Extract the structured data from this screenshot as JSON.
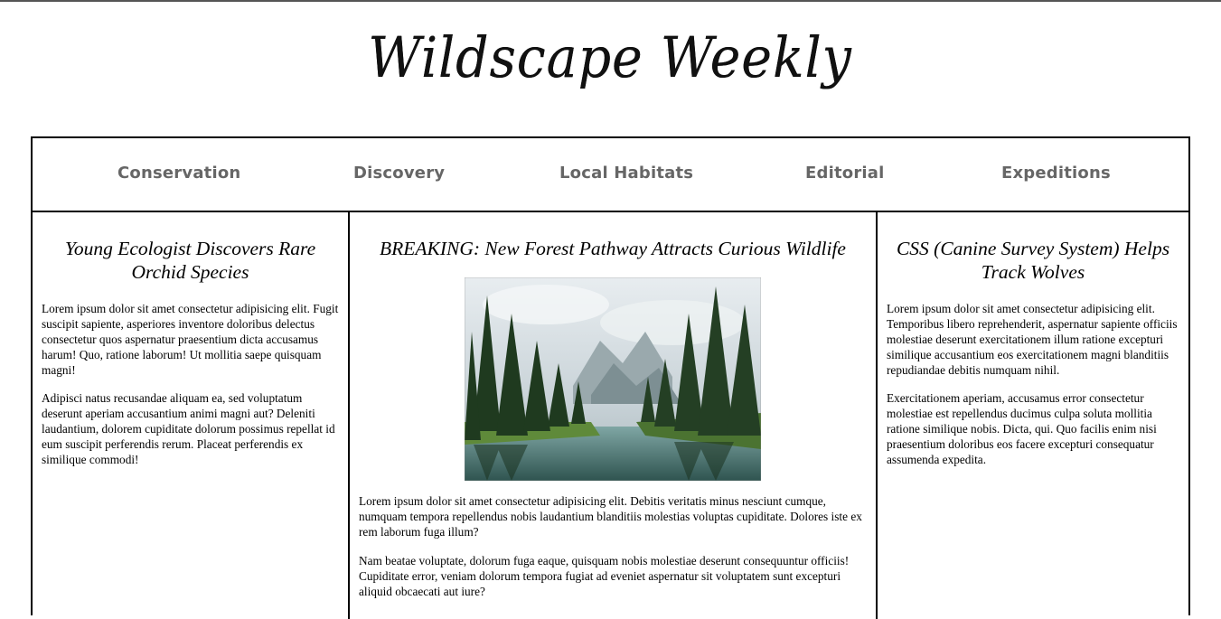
{
  "masthead": {
    "title": "Wildscape Weekly"
  },
  "nav": {
    "items": [
      {
        "label": "Conservation"
      },
      {
        "label": "Discovery"
      },
      {
        "label": "Local Habitats"
      },
      {
        "label": "Editorial"
      },
      {
        "label": "Expeditions"
      }
    ]
  },
  "articles": {
    "left": {
      "headline": "Young Ecologist Discovers Rare Orchid Species",
      "paragraphs": [
        "Lorem ipsum dolor sit amet consectetur adipisicing elit. Fugit suscipit sapiente, asperiores inventore doloribus delectus consectetur quos aspernatur praesentium dicta accusamus harum! Quo, ratione laborum! Ut mollitia saepe quisquam magni!",
        "Adipisci natus recusandae aliquam ea, sed voluptatum deserunt aperiam accusantium animi magni aut? Deleniti laudantium, dolorem cupiditate dolorum possimus repellat id eum suscipit perferendis rerum. Placeat perferendis ex similique commodi!"
      ]
    },
    "center": {
      "headline": "BREAKING: New Forest Pathway Attracts Curious Wildlife",
      "image_icon": "forest-lake-photo",
      "paragraphs": [
        "Lorem ipsum dolor sit amet consectetur adipisicing elit. Debitis veritatis minus nesciunt cumque, numquam tempora repellendus nobis laudantium blanditiis molestias voluptas cupiditate. Dolores iste ex rem laborum fuga illum?",
        "Nam beatae voluptate, dolorum fuga eaque, quisquam nobis molestiae deserunt consequuntur officiis! Cupiditate error, veniam dolorum tempora fugiat ad eveniet aspernatur sit voluptatem sunt excepturi aliquid obcaecati aut iure?"
      ]
    },
    "right": {
      "headline": "CSS (Canine Survey System) Helps Track Wolves",
      "paragraphs": [
        "Lorem ipsum dolor sit amet consectetur adipisicing elit. Temporibus libero reprehenderit, aspernatur sapiente officiis molestiae deserunt exercitationem illum ratione excepturi similique accusantium eos exercitationem magni blanditiis repudiandae debitis numquam nihil.",
        "Exercitationem aperiam, accusamus error consectetur molestiae est repellendus ducimus culpa soluta mollitia ratione similique nobis. Dicta, qui. Quo facilis enim nisi praesentium doloribus eos facere excepturi consequatur assumenda expedita."
      ]
    }
  },
  "colors": {
    "nav_text": "#666666",
    "border": "#000000"
  }
}
